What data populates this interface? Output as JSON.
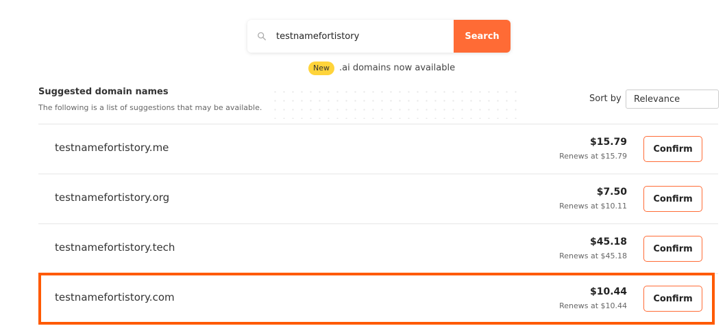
{
  "search": {
    "query": "testnamefortistory",
    "button_label": "Search"
  },
  "promo": {
    "badge": "New",
    "text": ".ai domains now available"
  },
  "results": {
    "heading": "Suggested domain names",
    "subheading": "The following is a list of suggestions that may be available.",
    "sort_label": "Sort by",
    "sort_value": "Relevance",
    "rows": [
      {
        "domain": "testnamefortistory.me",
        "price": "$15.79",
        "renews": "Renews at $15.79",
        "button": "Confirm"
      },
      {
        "domain": "testnamefortistory.org",
        "price": "$7.50",
        "renews": "Renews at $10.11",
        "button": "Confirm"
      },
      {
        "domain": "testnamefortistory.tech",
        "price": "$45.18",
        "renews": "Renews at $45.18",
        "button": "Confirm"
      },
      {
        "domain": "testnamefortistory.com",
        "price": "$10.44",
        "renews": "Renews at $10.44",
        "button": "Confirm"
      }
    ]
  },
  "colors": {
    "accent": "#ff6b35",
    "highlight_border": "#ff5a00",
    "badge_bg": "#ffd43b"
  }
}
